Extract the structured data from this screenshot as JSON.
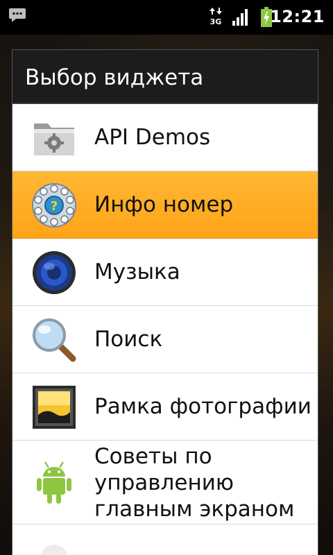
{
  "status_bar": {
    "time": "12:21",
    "network": "3G",
    "icons": [
      "notification-message-icon",
      "3g-data-icon",
      "signal-strength-icon",
      "battery-charging-icon"
    ]
  },
  "dialog": {
    "title": "Выбор виджета",
    "items": [
      {
        "label": "API Demos",
        "icon": "folder-gear-icon",
        "selected": false
      },
      {
        "label": "Инфо номер",
        "icon": "rotary-phone-dial-icon",
        "selected": true
      },
      {
        "label": "Музыка",
        "icon": "speaker-icon",
        "selected": false
      },
      {
        "label": "Поиск",
        "icon": "magnifier-icon",
        "selected": false
      },
      {
        "label": "Рамка фотографии",
        "icon": "picture-frame-icon",
        "selected": false
      },
      {
        "label": "Советы по\nуправлению\nглавным экраном",
        "icon": "android-robot-icon",
        "selected": false
      }
    ]
  },
  "colors": {
    "selection": "#ffa419",
    "title_bar": "#1c1c1c",
    "status_bar": "#000000"
  }
}
